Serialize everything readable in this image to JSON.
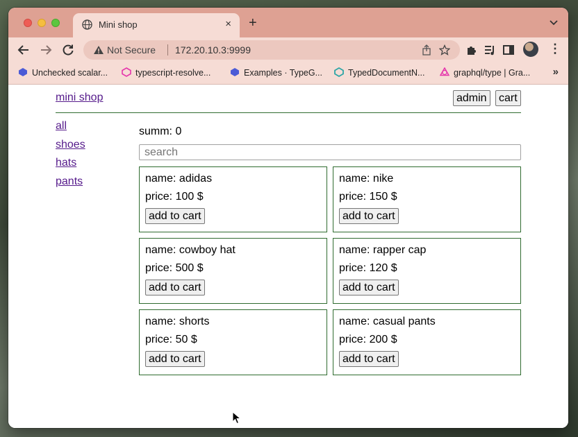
{
  "browser": {
    "tab": {
      "title": "Mini shop",
      "close": "×"
    },
    "new_tab": "+",
    "omnibox": {
      "security": "Not Secure",
      "url": "172.20.10.3:9999"
    },
    "bookmarks": [
      {
        "label": "Unchecked scalar...",
        "icon_color": "#4b5bd6"
      },
      {
        "label": "typescript-resolve...",
        "icon_color": "#e535ab"
      },
      {
        "label": "Examples · TypeG...",
        "icon_color": "#4b5bd6"
      },
      {
        "label": "TypedDocumentN...",
        "icon_color": "#2ea6a6"
      },
      {
        "label": "graphql/type | Gra...",
        "icon_color": "#e535ab"
      }
    ],
    "bookmarks_more": "»",
    "menu": "⋮"
  },
  "shop": {
    "logo": "mini shop",
    "admin_label": "admin",
    "cart_label": "cart",
    "categories": [
      "all",
      "shoes",
      "hats",
      "pants"
    ],
    "summ": "summ: 0",
    "search_placeholder": "search",
    "products": [
      {
        "name": "name: adidas",
        "price": "price: 100 $",
        "button": "add to cart"
      },
      {
        "name": "name: nike",
        "price": "price: 150 $",
        "button": "add to cart"
      },
      {
        "name": "name: cowboy hat",
        "price": "price: 500 $",
        "button": "add to cart"
      },
      {
        "name": "name: rapper cap",
        "price": "price: 120 $",
        "button": "add to cart"
      },
      {
        "name": "name: shorts",
        "price": "price: 50 $",
        "button": "add to cart"
      },
      {
        "name": "name: casual pants",
        "price": "price: 200 $",
        "button": "add to cart"
      }
    ]
  },
  "colors": {
    "tabstrip": "#dea193",
    "toolbar": "#f6dcd5",
    "link": "#551a8b",
    "card_border": "#2f6b2f"
  }
}
